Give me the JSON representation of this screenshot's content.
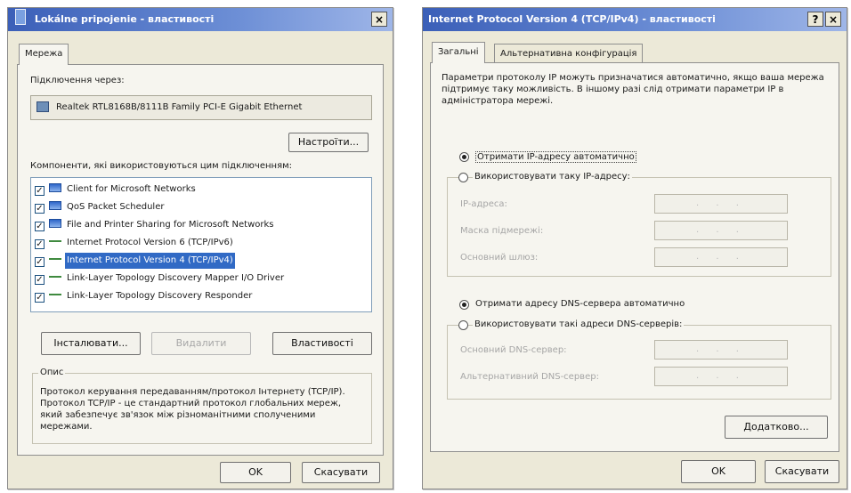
{
  "left_window": {
    "title": "Lokálne pripojenie - властивості",
    "close_glyph": "×",
    "tab": "Мережа",
    "connect_label": "Підключення через:",
    "adapter": "Realtek RTL8168B/8111B Family PCI-E Gigabit Ethernet",
    "configure_button": "Настроїти...",
    "components_label": "Компоненти, які використовуються цим підключенням:",
    "check_glyph": "✓",
    "components": [
      {
        "label": "Client for Microsoft Networks",
        "checked": true,
        "icon": "network-client-icon"
      },
      {
        "label": "QoS Packet Scheduler",
        "checked": true,
        "icon": "network-service-icon"
      },
      {
        "label": "File and Printer Sharing for Microsoft Networks",
        "checked": true,
        "icon": "network-service-icon"
      },
      {
        "label": "Internet Protocol Version 6 (TCP/IPv6)",
        "checked": true,
        "icon": "protocol-icon"
      },
      {
        "label": "Internet Protocol Version 4 (TCP/IPv4)",
        "checked": true,
        "icon": "protocol-icon",
        "selected": true
      },
      {
        "label": "Link-Layer Topology Discovery Mapper I/O Driver",
        "checked": true,
        "icon": "protocol-icon"
      },
      {
        "label": "Link-Layer Topology Discovery Responder",
        "checked": true,
        "icon": "protocol-icon"
      }
    ],
    "install_button": "Інсталювати...",
    "remove_button": "Видалити",
    "properties_button": "Властивості",
    "description_title": "Опис",
    "description": "Протокол керування передаванням/протокол Інтернету (TCP/IP). Протокол TCP/IP - це стандартний протокол глобальних мереж, який забезпечує зв'язок між різноманітними сполученими мережами.",
    "ok_button": "OK",
    "cancel_button": "Скасувати"
  },
  "right_window": {
    "title": "Internet Protocol Version 4 (TCP/IPv4) - властивості",
    "help_glyph": "?",
    "close_glyph": "×",
    "tabs": [
      "Загальні",
      "Альтернативна конфігурація"
    ],
    "intro": "Параметри протоколу IP можуть призначатися автоматично, якщо ваша мережа підтримує таку можливість. В іншому разі слід отримати параметри IP в адміністратора мережі.",
    "auto_ip": "Отримати IP-адресу автоматично",
    "manual_ip": "Використовувати таку IP-адресу:",
    "ip_address": "IP-адреса:",
    "subnet_mask": "Маска підмережі:",
    "gateway": "Основний шлюз:",
    "auto_dns": "Отримати адресу DNS-сервера автоматично",
    "manual_dns": "Використовувати такі адреси DNS-серверів:",
    "preferred_dns": "Основний DNS-сервер:",
    "alternate_dns": "Альтернативний DNS-сервер:",
    "ip_placeholder": ". . .",
    "advanced_button": "Додатково...",
    "ok_button": "OK",
    "cancel_button": "Скасувати"
  }
}
